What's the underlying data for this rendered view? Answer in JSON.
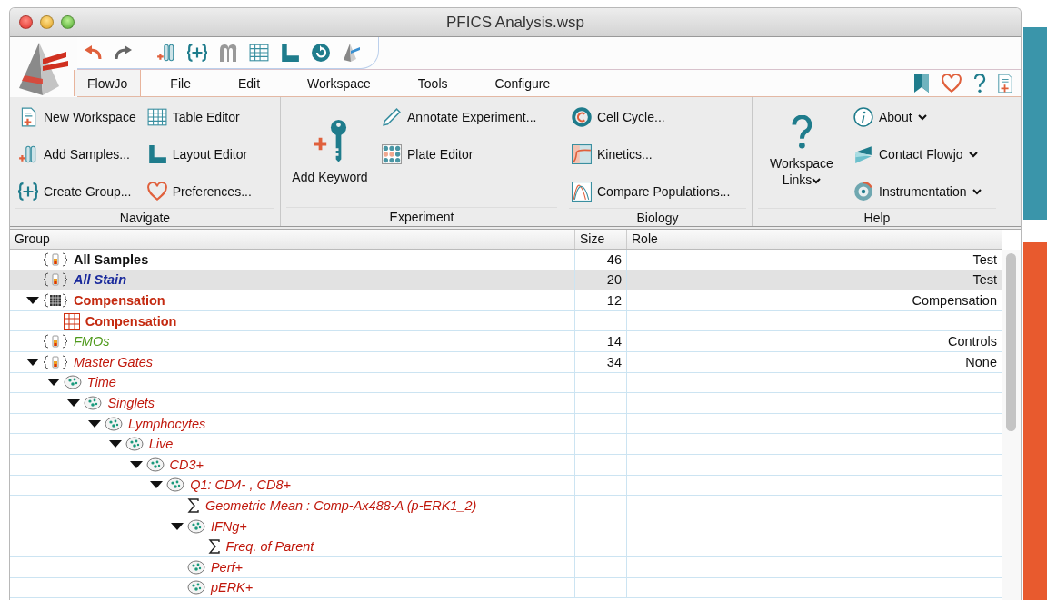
{
  "window": {
    "title": "PFICS Analysis.wsp"
  },
  "menu_tabs": [
    {
      "label": "FlowJo",
      "selected": true
    },
    {
      "label": "File",
      "selected": false
    },
    {
      "label": "Edit",
      "selected": false
    },
    {
      "label": "Workspace",
      "selected": false
    },
    {
      "label": "Tools",
      "selected": false
    },
    {
      "label": "Configure",
      "selected": false
    }
  ],
  "ribbon": {
    "groups": [
      {
        "label": "Navigate",
        "columns": [
          [
            {
              "label": "New Workspace",
              "kind": "small",
              "dropdown": false
            },
            {
              "label": "Add Samples...",
              "kind": "small",
              "dropdown": false
            },
            {
              "label": "Create Group...",
              "kind": "small",
              "dropdown": false
            }
          ],
          [
            {
              "label": "Table Editor",
              "kind": "small",
              "dropdown": false
            },
            {
              "label": "Layout Editor",
              "kind": "small",
              "dropdown": false
            },
            {
              "label": "Preferences...",
              "kind": "small",
              "dropdown": false
            }
          ]
        ]
      },
      {
        "label": "Experiment",
        "columns": [
          [
            {
              "label": "Add Keyword",
              "kind": "large",
              "dropdown": false
            }
          ],
          [
            {
              "label": "Annotate Experiment...",
              "kind": "small",
              "dropdown": false
            },
            {
              "label": "Plate Editor",
              "kind": "small",
              "dropdown": false
            }
          ]
        ]
      },
      {
        "label": "Biology",
        "columns": [
          [
            {
              "label": "Cell Cycle...",
              "kind": "small",
              "dropdown": false
            },
            {
              "label": "Kinetics...",
              "kind": "small",
              "dropdown": false
            },
            {
              "label": "Compare Populations...",
              "kind": "small",
              "dropdown": false
            }
          ]
        ]
      },
      {
        "label": "Help",
        "columns": [
          [
            {
              "label": "Workspace Links",
              "kind": "large",
              "dropdown": true
            }
          ],
          [
            {
              "label": "About",
              "kind": "small",
              "dropdown": true
            },
            {
              "label": "Contact Flowjo",
              "kind": "small",
              "dropdown": true
            },
            {
              "label": "Instrumentation",
              "kind": "small",
              "dropdown": true
            }
          ]
        ]
      }
    ]
  },
  "table": {
    "columns": [
      "Group",
      "Size",
      "Role"
    ],
    "rows": [
      {
        "name": "All Samples",
        "kind": "group",
        "bold": true,
        "italic": false,
        "color": "#111111",
        "size": "46",
        "role": "Test",
        "selected": false
      },
      {
        "name": "All Stain",
        "kind": "group",
        "bold": true,
        "italic": true,
        "color": "#1a2a9c",
        "size": "20",
        "role": "Test",
        "selected": true
      },
      {
        "name": "Compensation",
        "kind": "matrix-group",
        "bold": true,
        "italic": false,
        "color": "#c42a10",
        "size": "12",
        "role": "Compensation",
        "selected": false,
        "expanded": true,
        "children": [
          {
            "name": "Compensation",
            "kind": "matrix",
            "bold": true,
            "italic": false,
            "color": "#c42a10",
            "selected": false
          }
        ]
      },
      {
        "name": "FMOs",
        "kind": "group",
        "bold": false,
        "italic": true,
        "color": "#4f9a1c",
        "size": "14",
        "role": "Controls",
        "selected": false
      },
      {
        "name": "Master Gates",
        "kind": "group",
        "bold": false,
        "italic": true,
        "color": "#c0180c",
        "size": "34",
        "role": "None",
        "selected": false,
        "expanded": true,
        "children": [
          {
            "name": "Time",
            "kind": "gate",
            "bold": false,
            "italic": true,
            "color": "#c0180c",
            "selected": false,
            "expanded": true,
            "children": [
              {
                "name": "Singlets",
                "kind": "gate",
                "bold": false,
                "italic": true,
                "color": "#c0180c",
                "selected": false,
                "expanded": true,
                "children": [
                  {
                    "name": "Lymphocytes",
                    "kind": "gate",
                    "bold": false,
                    "italic": true,
                    "color": "#c0180c",
                    "selected": false,
                    "expanded": true,
                    "children": [
                      {
                        "name": "Live",
                        "kind": "gate",
                        "bold": false,
                        "italic": true,
                        "color": "#c0180c",
                        "selected": false,
                        "expanded": true,
                        "children": [
                          {
                            "name": "CD3+",
                            "kind": "gate",
                            "bold": false,
                            "italic": true,
                            "color": "#c0180c",
                            "selected": false,
                            "expanded": true,
                            "children": [
                              {
                                "name": "Q1: CD4- , CD8+",
                                "kind": "gate",
                                "bold": false,
                                "italic": true,
                                "color": "#c0180c",
                                "selected": false,
                                "expanded": true,
                                "children": [
                                  {
                                    "name": "Geometric Mean : Comp-Ax488-A (p-ERK1_2)",
                                    "kind": "statistic",
                                    "bold": false,
                                    "italic": true,
                                    "color": "#c0180c",
                                    "selected": false
                                  },
                                  {
                                    "name": "IFNg+",
                                    "kind": "gate",
                                    "bold": false,
                                    "italic": true,
                                    "color": "#c0180c",
                                    "selected": false,
                                    "expanded": true,
                                    "children": [
                                      {
                                        "name": "Freq. of Parent",
                                        "kind": "statistic",
                                        "bold": false,
                                        "italic": true,
                                        "color": "#c0180c",
                                        "selected": false
                                      }
                                    ]
                                  },
                                  {
                                    "name": "Perf+",
                                    "kind": "gate",
                                    "bold": false,
                                    "italic": true,
                                    "color": "#c0180c",
                                    "selected": false
                                  },
                                  {
                                    "name": "pERK+",
                                    "kind": "gate",
                                    "bold": false,
                                    "italic": true,
                                    "color": "#c0180c",
                                    "selected": false
                                  }
                                ]
                              }
                            ]
                          }
                        ]
                      }
                    ]
                  }
                ]
              }
            ]
          }
        ]
      }
    ]
  }
}
